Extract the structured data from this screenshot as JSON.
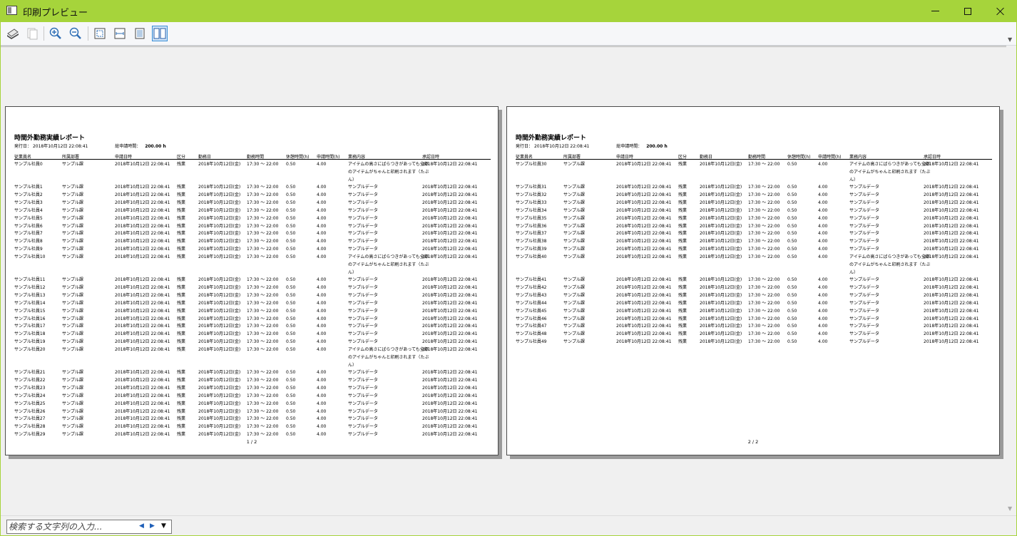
{
  "window": {
    "title": "印刷プレビュー"
  },
  "toolbar": {
    "buttons": [
      "print-icon",
      "copy-icon",
      "zoom-in-icon",
      "zoom-out-icon",
      "fit-page-icon",
      "fit-width-icon",
      "single-page-icon",
      "two-page-icon"
    ]
  },
  "report": {
    "title": "時間外勤務実績レポート",
    "issued_label": "発行日：",
    "issued_date": "2018年10月12日 22:08:41",
    "total_label": "総申請時間：",
    "total_value": "200.00 h",
    "columns": [
      "従業員名",
      "所属部署",
      "申請日時",
      "区分",
      "勤務日",
      "勤務時間",
      "休憩時間(h)",
      "申請時間(h)",
      "業務内容",
      "承認日時"
    ],
    "common": {
      "dept": "サンプル課",
      "date": "2018年10月12日 22:08:41",
      "kubun": "残業",
      "wday": "2018年10月12日(金)",
      "wtime": "17:30 ～ 22:00",
      "rest": "0.50",
      "req": "4.00",
      "work_short": "サンプルデータ",
      "work_long": "アイテムの高さにばらつきがあっても全部のアイテムがちゃんと印刷されます（たぶん）",
      "appr": "2018年10月12日 22:08:41"
    },
    "employee_prefix": "サンプル社員"
  },
  "pages": [
    {
      "page_label": "1 / 2",
      "start": 0,
      "end": 29
    },
    {
      "page_label": "2 / 2",
      "start": 30,
      "end": 49
    }
  ],
  "search": {
    "placeholder": "検索する文字列の入力..."
  }
}
